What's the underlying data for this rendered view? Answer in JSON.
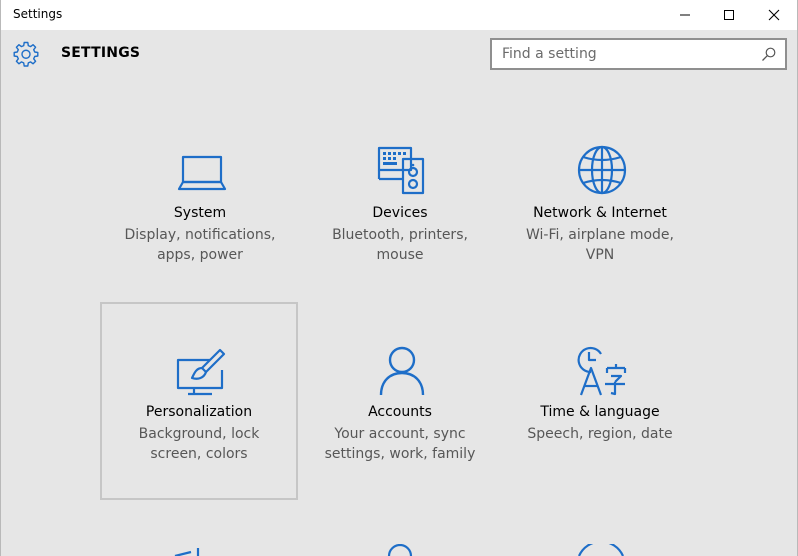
{
  "window": {
    "title": "Settings",
    "controls": [
      "minimize",
      "maximize",
      "close"
    ]
  },
  "header": {
    "title": "SETTINGS",
    "icon": "gear-icon"
  },
  "search": {
    "placeholder": "Find a setting",
    "value": "",
    "icon": "search-icon"
  },
  "accent_color": "#1e6ec8",
  "tiles": [
    {
      "name": "System",
      "description": "Display, notifications, apps, power",
      "icon": "laptop-icon"
    },
    {
      "name": "Devices",
      "description": "Bluetooth, printers, mouse",
      "icon": "keyboard-speaker-icon"
    },
    {
      "name": "Network & Internet",
      "description": "Wi-Fi, airplane mode, VPN",
      "icon": "globe-icon"
    },
    {
      "name": "Personalization",
      "description": "Background, lock screen, colors",
      "icon": "paintbrush-monitor-icon"
    },
    {
      "name": "Accounts",
      "description": "Your account, sync settings, work, family",
      "icon": "person-icon"
    },
    {
      "name": "Time & language",
      "description": "Speech, region, date",
      "icon": "clock-language-icon"
    }
  ]
}
